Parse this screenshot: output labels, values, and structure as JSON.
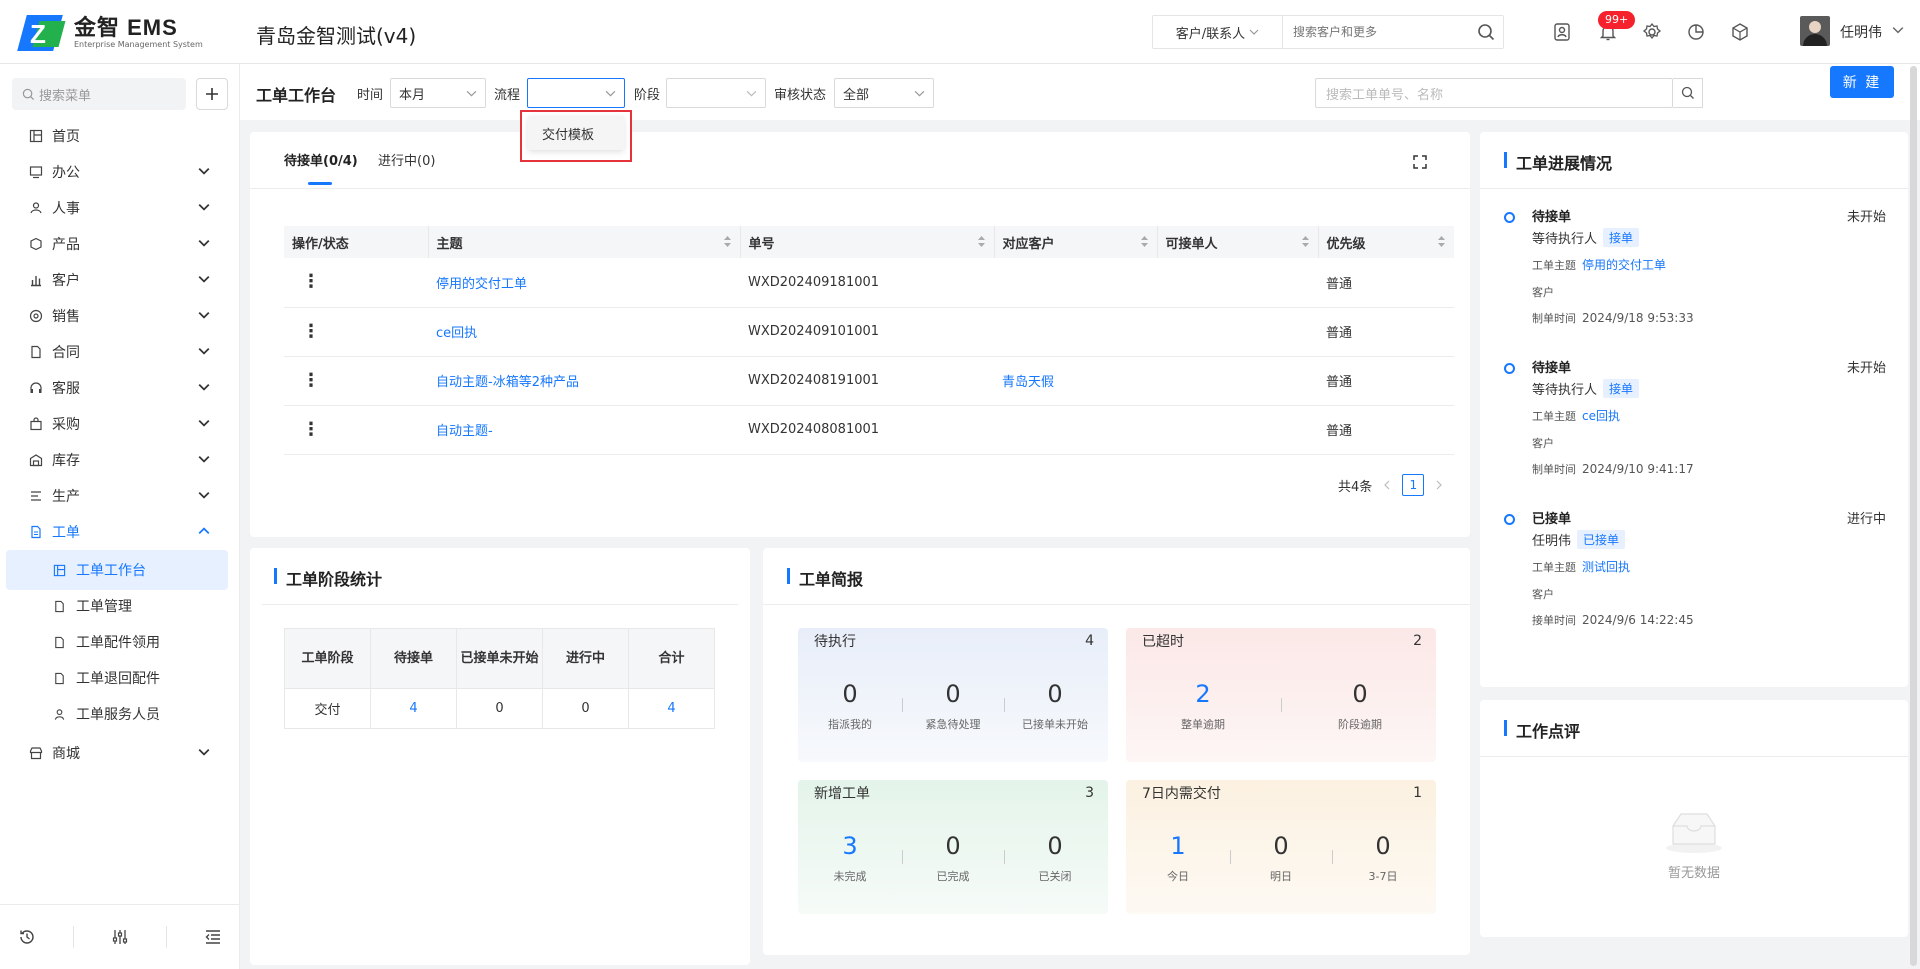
{
  "header": {
    "logo_name": "金智 EMS",
    "logo_sub": "Enterprise Management System",
    "company": "青岛金智测试(v4)",
    "search_type": "客户/联系人",
    "search_placeholder": "搜索客户和更多",
    "notif_badge": "99+",
    "user_name": "任明伟"
  },
  "sidebar": {
    "search_placeholder": "搜索菜单",
    "menu": [
      {
        "label": "首页"
      },
      {
        "label": "办公"
      },
      {
        "label": "人事"
      },
      {
        "label": "产品"
      },
      {
        "label": "客户"
      },
      {
        "label": "销售"
      },
      {
        "label": "合同"
      },
      {
        "label": "客服"
      },
      {
        "label": "采购"
      },
      {
        "label": "库存"
      },
      {
        "label": "生产"
      },
      {
        "label": "工单"
      }
    ],
    "submenu": [
      {
        "label": "工单工作台"
      },
      {
        "label": "工单管理"
      },
      {
        "label": "工单配件领用"
      },
      {
        "label": "工单退回配件"
      },
      {
        "label": "工单服务人员"
      }
    ],
    "menu_last": "商城"
  },
  "filters": {
    "title": "工单工作台",
    "time_label": "时间",
    "time_value": "本月",
    "flow_label": "流程",
    "flow_value": "",
    "stage_label": "阶段",
    "stage_value": "",
    "audit_label": "审核状态",
    "audit_value": "全部",
    "search_placeholder": "搜索工单单号、名称",
    "new_button": "新 建"
  },
  "dropdown": {
    "item": "交付模板"
  },
  "tabs": [
    {
      "label": "待接单(0/4)"
    },
    {
      "label": "进行中(0)"
    }
  ],
  "table": {
    "headers": [
      "操作/状态",
      "主题",
      "单号",
      "对应客户",
      "可接单人",
      "优先级"
    ],
    "rows": [
      {
        "ops": "⋮",
        "subject": "停用的交付工单",
        "number": "WXD202409181001",
        "customer": "",
        "receiver": "",
        "priority": "普通"
      },
      {
        "ops": "⋮",
        "subject": "ce回执",
        "number": "WXD202409101001",
        "customer": "",
        "receiver": "",
        "priority": "普通"
      },
      {
        "ops": "⋮",
        "subject": "自动主题-冰箱等2种产品",
        "number": "WXD202408191001",
        "customer": "青岛天假",
        "receiver": "",
        "priority": "普通"
      },
      {
        "ops": "⋮",
        "subject": "自动主题-",
        "number": "WXD202408081001",
        "customer": "",
        "receiver": "",
        "priority": "普通"
      }
    ],
    "total": "共4条",
    "page": "1"
  },
  "progress": {
    "title": "工单进展情况",
    "items": [
      {
        "type": "待接单",
        "status": "未开始",
        "who": "等待执行人",
        "tag": "接单",
        "subject_label": "工单主题",
        "subject": "停用的交付工单",
        "customer_label": "客户",
        "customer": "",
        "time_label": "制单时间",
        "time": "2024/9/18 9:53:33"
      },
      {
        "type": "待接单",
        "status": "未开始",
        "who": "等待执行人",
        "tag": "接单",
        "subject_label": "工单主题",
        "subject": "ce回执",
        "customer_label": "客户",
        "customer": "",
        "time_label": "制单时间",
        "time": "2024/9/10 9:41:17"
      },
      {
        "type": "已接单",
        "status": "进行中",
        "who": "任明伟",
        "tag": "已接单",
        "subject_label": "工单主题",
        "subject": "测试回执",
        "customer_label": "客户",
        "customer": "",
        "time_label": "接单时间",
        "time": "2024/9/6 14:22:45"
      }
    ]
  },
  "stage": {
    "title": "工单阶段统计",
    "headers": [
      "工单阶段",
      "待接单",
      "已接单未开始",
      "进行中",
      "合计"
    ],
    "rows": [
      [
        "交付",
        "4",
        "0",
        "0",
        "4"
      ]
    ]
  },
  "brief": {
    "title": "工单简报",
    "cards": [
      {
        "title": "待执行",
        "count": "4",
        "color": "#eef3fb",
        "stats": [
          {
            "value": "0",
            "label": "指派我的"
          },
          {
            "value": "0",
            "label": "紧急待处理"
          },
          {
            "value": "0",
            "label": "已接单未开始"
          }
        ]
      },
      {
        "title": "已超时",
        "count": "2",
        "color": "#fdf0ef",
        "stats": [
          {
            "value": "2",
            "label": "整单逾期"
          },
          {
            "value": "0",
            "label": "阶段逾期"
          }
        ]
      },
      {
        "title": "新增工单",
        "count": "3",
        "color": "#eef8f2",
        "stats": [
          {
            "value": "3",
            "label": "未完成"
          },
          {
            "value": "0",
            "label": "已完成"
          },
          {
            "value": "0",
            "label": "已关闭"
          }
        ]
      },
      {
        "title": "7日内需交付",
        "count": "1",
        "color": "#fdf6ec",
        "stats": [
          {
            "value": "1",
            "label": "今日"
          },
          {
            "value": "0",
            "label": "明日"
          },
          {
            "value": "0",
            "label": "3-7日"
          }
        ]
      }
    ]
  },
  "review": {
    "title": "工作点评",
    "empty": "暂无数据"
  }
}
